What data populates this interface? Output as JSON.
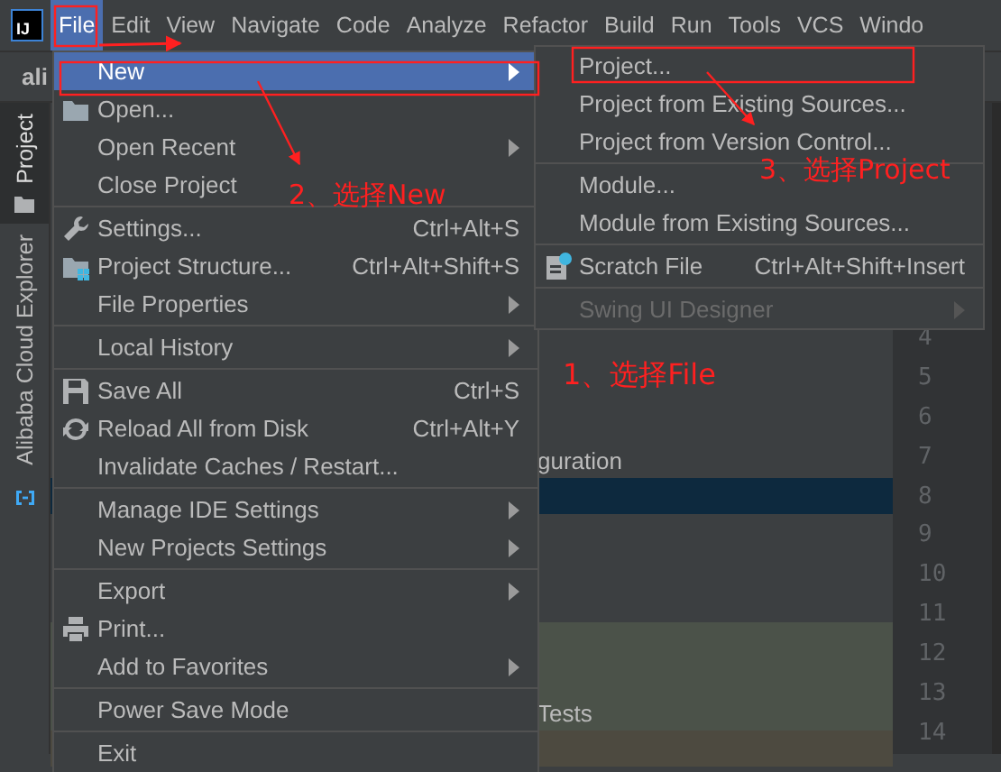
{
  "logo": {
    "text": "IJ"
  },
  "menubar": [
    {
      "label": "File",
      "selected": true
    },
    {
      "label": "Edit",
      "selected": false
    },
    {
      "label": "View",
      "selected": false
    },
    {
      "label": "Navigate",
      "selected": false
    },
    {
      "label": "Code",
      "selected": false
    },
    {
      "label": "Analyze",
      "selected": false
    },
    {
      "label": "Refactor",
      "selected": false
    },
    {
      "label": "Build",
      "selected": false
    },
    {
      "label": "Run",
      "selected": false
    },
    {
      "label": "Tools",
      "selected": false
    },
    {
      "label": "VCS",
      "selected": false
    },
    {
      "label": "Windo",
      "selected": false
    }
  ],
  "toolbar": {
    "project_name": "ali"
  },
  "side_tabs": [
    {
      "label": "Project",
      "selected": true
    },
    {
      "label": "Alibaba Cloud Explorer",
      "selected": false
    }
  ],
  "tree_rows": [
    {
      "text": "guration",
      "selected": false
    },
    {
      "selected": true
    },
    {
      "text": "Tests",
      "selected": false
    }
  ],
  "line_numbers": [
    "4",
    "5",
    "6",
    "7",
    "8",
    "9",
    "10",
    "11",
    "12",
    "13",
    "14"
  ],
  "file_menu": {
    "groups": [
      [
        {
          "label": "New",
          "submenu": true,
          "selected": true,
          "disabled": false
        },
        {
          "label": "Open...",
          "submenu": false,
          "selected": false,
          "disabled": false
        },
        {
          "label": "Open Recent",
          "submenu": true,
          "selected": false,
          "disabled": false
        },
        {
          "label": "Close Project",
          "submenu": false,
          "selected": false,
          "disabled": false
        }
      ],
      [
        {
          "label": "Settings...",
          "shortcut": "Ctrl+Alt+S",
          "submenu": false,
          "selected": false,
          "disabled": false
        },
        {
          "label": "Project Structure...",
          "shortcut": "Ctrl+Alt+Shift+S",
          "submenu": false,
          "selected": false,
          "disabled": false
        },
        {
          "label": "File Properties",
          "submenu": true,
          "selected": false,
          "disabled": false
        }
      ],
      [
        {
          "label": "Local History",
          "submenu": true,
          "selected": false,
          "disabled": false
        }
      ],
      [
        {
          "label": "Save All",
          "shortcut": "Ctrl+S",
          "submenu": false,
          "selected": false,
          "disabled": false
        },
        {
          "label": "Reload All from Disk",
          "shortcut": "Ctrl+Alt+Y",
          "submenu": false,
          "selected": false,
          "disabled": false
        },
        {
          "label": "Invalidate Caches / Restart...",
          "submenu": false,
          "selected": false,
          "disabled": false
        }
      ],
      [
        {
          "label": "Manage IDE Settings",
          "submenu": true,
          "selected": false,
          "disabled": false
        },
        {
          "label": "New Projects Settings",
          "submenu": true,
          "selected": false,
          "disabled": false
        }
      ],
      [
        {
          "label": "Export",
          "submenu": true,
          "selected": false,
          "disabled": false
        },
        {
          "label": "Print...",
          "submenu": false,
          "selected": false,
          "disabled": false
        },
        {
          "label": "Add to Favorites",
          "submenu": true,
          "selected": false,
          "disabled": false
        }
      ],
      [
        {
          "label": "Power Save Mode",
          "submenu": false,
          "selected": false,
          "disabled": false
        }
      ],
      [
        {
          "label": "Exit",
          "submenu": false,
          "selected": false,
          "disabled": false
        }
      ]
    ]
  },
  "new_submenu": {
    "groups": [
      [
        {
          "label": "Project...",
          "submenu": false,
          "selected": false,
          "disabled": false
        },
        {
          "label": "Project from Existing Sources...",
          "submenu": false,
          "selected": false,
          "disabled": false
        },
        {
          "label": "Project from Version Control...",
          "submenu": false,
          "selected": false,
          "disabled": false
        }
      ],
      [
        {
          "label": "Module...",
          "submenu": false,
          "selected": false,
          "disabled": false
        },
        {
          "label": "Module from Existing Sources...",
          "submenu": false,
          "selected": false,
          "disabled": false
        }
      ],
      [
        {
          "label": "Scratch File",
          "shortcut": "Ctrl+Alt+Shift+Insert",
          "submenu": false,
          "selected": false,
          "disabled": false
        }
      ],
      [
        {
          "label": "Swing UI Designer",
          "submenu": true,
          "selected": false,
          "disabled": true
        }
      ]
    ]
  },
  "annotations": [
    {
      "text": "1、选择File"
    },
    {
      "text": "2、选择New"
    },
    {
      "text": "3、选择Project"
    }
  ]
}
